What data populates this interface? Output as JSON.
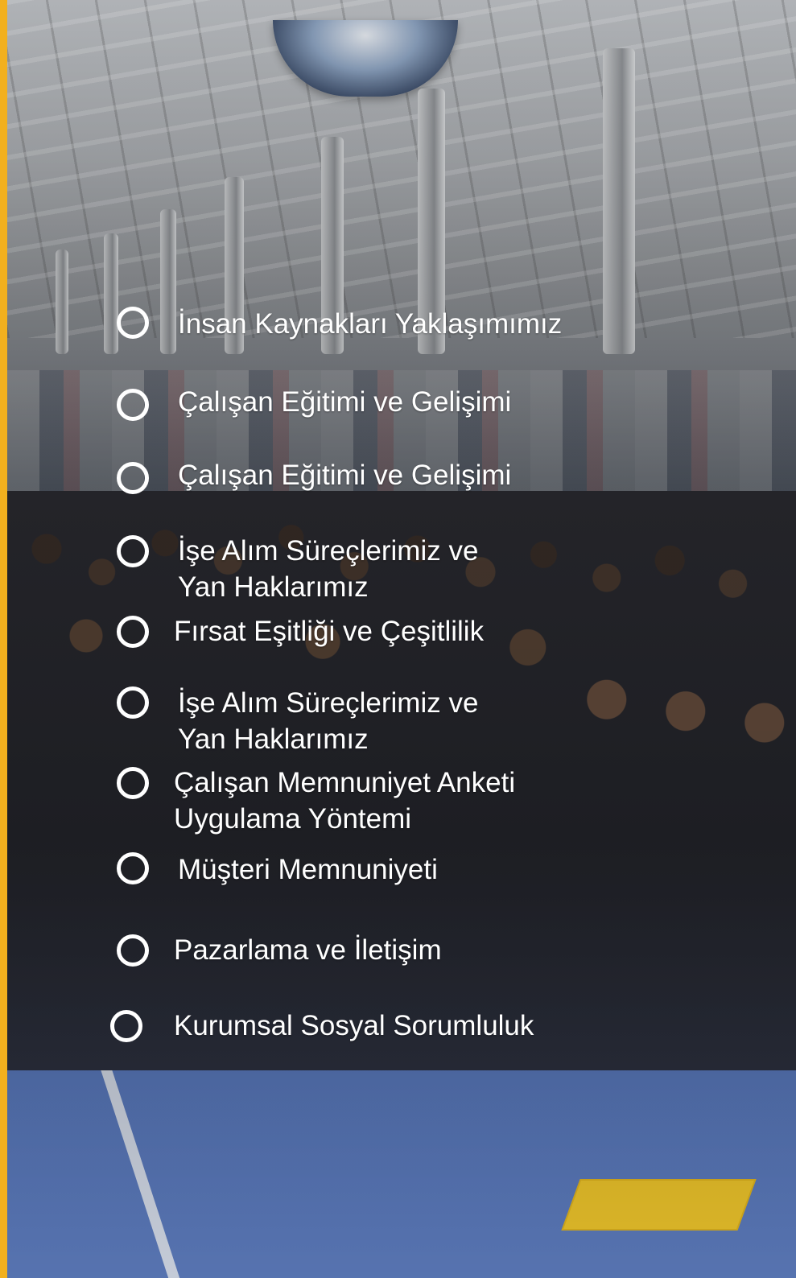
{
  "background": {
    "photo_description_icon": "factory-workers-photo",
    "accent_bar_color": "#f2b01e",
    "floor_color": "#5776b8"
  },
  "menu": {
    "items": [
      {
        "label": "İnsan Kaynakları Yaklaşımımız"
      },
      {
        "label": "Çalışan Eğitimi ve Gelişimi"
      },
      {
        "label": "Çalışan Eğitimi ve Gelişimi"
      },
      {
        "label_line1": "İşe Alım Süreçlerimiz ve",
        "label_line2": "Yan Haklarımız"
      },
      {
        "label": "Fırsat Eşitliği ve Çeşitlilik"
      },
      {
        "label_line1": "İşe Alım Süreçlerimiz ve",
        "label_line2": "Yan Haklarımız"
      },
      {
        "label_line1": "Çalışan Memnuniyet Anketi",
        "label_line2": "Uygulama Yöntemi"
      },
      {
        "label": "Müşteri Memnuniyeti"
      },
      {
        "label": "Pazarlama ve İletişim"
      },
      {
        "label": "Kurumsal Sosyal Sorumluluk"
      }
    ]
  }
}
